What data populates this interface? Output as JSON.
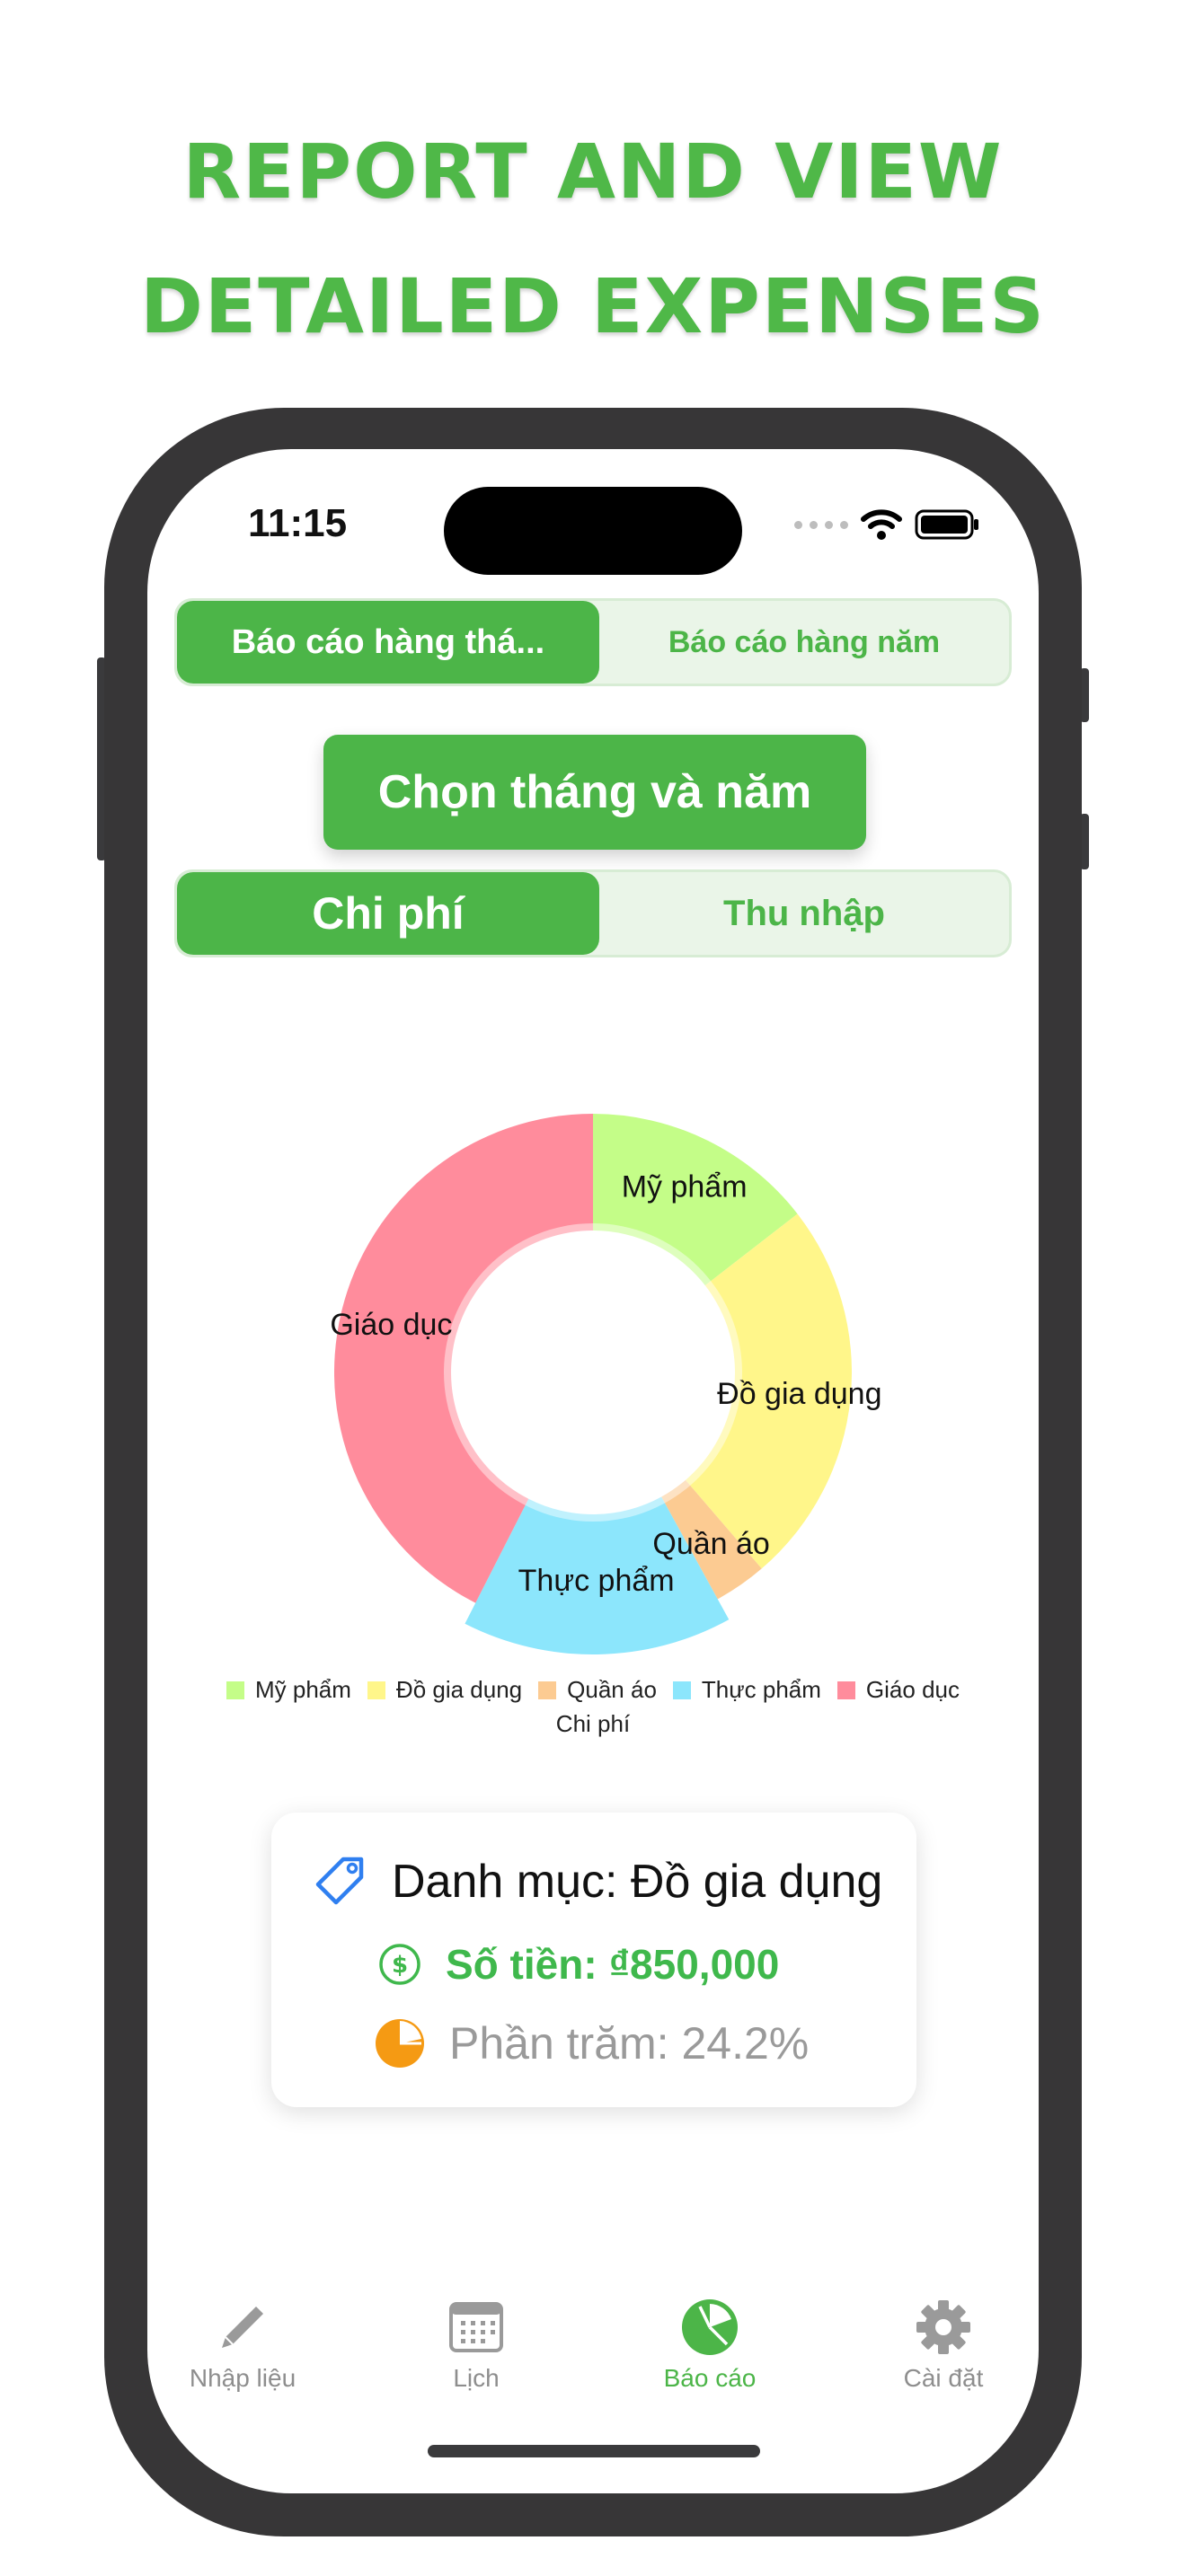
{
  "promo": {
    "line1": "REPORT AND VIEW",
    "line2": "DETAILED EXPENSES"
  },
  "status_bar": {
    "time": "11:15"
  },
  "report_period": {
    "active_label": "Báo cáo hàng thá...",
    "inactive_label": "Báo cáo hàng năm"
  },
  "pick_button": {
    "label": "Chọn tháng và năm"
  },
  "type_toggle": {
    "active_label": "Chi phí",
    "inactive_label": "Thu nhập"
  },
  "chart_data": {
    "type": "pie",
    "title": "",
    "categories": [
      "Mỹ phẩm",
      "Đồ gia dụng",
      "Quần áo",
      "Thực phẩm",
      "Giáo dục"
    ],
    "values": [
      14.5,
      24.2,
      3.3,
      15.5,
      42.5
    ],
    "colors": [
      "#c4fd88",
      "#fff68a",
      "#fccb92",
      "#8ce6fc",
      "#ff8c9c"
    ],
    "highlighted_index": 3,
    "donut": true,
    "legend_position": "bottom",
    "legend_caption": "Chi phí"
  },
  "detail_card": {
    "category_label": "Danh mục: Đồ gia dụng",
    "amount_label": "Số tiền: ₫850,000",
    "percent_label": "Phần trăm: 24.2%"
  },
  "tabs": [
    {
      "label": "Nhập liệu",
      "icon": "pencil-icon",
      "active": false
    },
    {
      "label": "Lịch",
      "icon": "calendar-icon",
      "active": false
    },
    {
      "label": "Báo cáo",
      "icon": "pie-chart-icon",
      "active": true
    },
    {
      "label": "Cài đặt",
      "icon": "gear-icon",
      "active": false
    }
  ],
  "colors": {
    "accent": "#4cb548",
    "headline": "#4fb848",
    "amount": "#3fb84c",
    "percent_icon": "#f59a13",
    "tag_icon": "#2f7ff0"
  }
}
